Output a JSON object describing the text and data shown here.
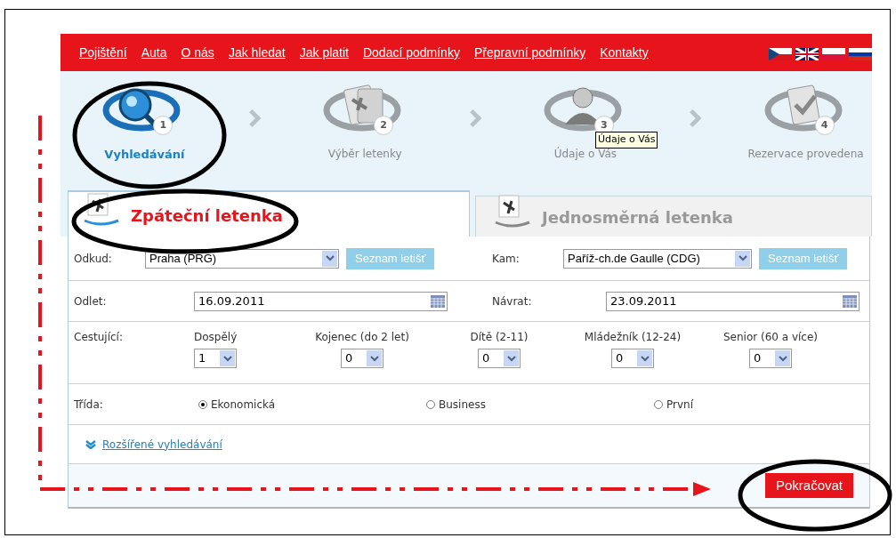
{
  "nav_links": [
    "Pojištění",
    "Auta",
    "O nás",
    "Jak hledat",
    "Jak platit",
    "Dodací podmínky",
    "Přepravní podmínky",
    "Kontakty"
  ],
  "steps": [
    {
      "kind": "search",
      "number": "1",
      "label": "Vyhledávání",
      "selected": true
    },
    {
      "kind": "ticket",
      "number": "2",
      "label": "Výběr letenky",
      "selected": false
    },
    {
      "kind": "person",
      "number": "3",
      "label": "Údaje o Vás",
      "selected": false
    },
    {
      "kind": "check",
      "number": "4",
      "label": "Rezervace provedena",
      "selected": false
    }
  ],
  "tooltip": "Údaje o Vás",
  "tabs": [
    {
      "label": "Zpáteční letenka",
      "selected": true
    },
    {
      "label": "Jednosměrná letenka",
      "selected": false
    }
  ],
  "route": [
    {
      "label": "Odkud:",
      "value": "Praha (PRG)",
      "button": "Seznam letišť"
    },
    {
      "label": "Kam:",
      "value": "Paříž-ch.de Gaulle (CDG)",
      "button": "Seznam letišť"
    }
  ],
  "dates": [
    {
      "label": "Odlet:",
      "value": "16.09.2011"
    },
    {
      "label": "Návrat:",
      "value": "23.09.2011"
    }
  ],
  "passengers": {
    "label": "Cestující:",
    "groups": [
      {
        "label": "Dospělý",
        "value": "1"
      },
      {
        "label": "Kojenec (do 2 let)",
        "value": "0"
      },
      {
        "label": "Dítě (2-11)",
        "value": "0"
      },
      {
        "label": "Mládežník (12-24)",
        "value": "0"
      },
      {
        "label": "Senior (60 a více)",
        "value": "0"
      }
    ]
  },
  "travel_class": {
    "label": "Třída:",
    "options": [
      {
        "label": "Ekonomická",
        "selected": true
      },
      {
        "label": "Business",
        "selected": false
      },
      {
        "label": "První",
        "selected": false
      }
    ]
  },
  "advanced_link": "Rozšířené vyhledávání",
  "continue_button": "Pokračovat"
}
